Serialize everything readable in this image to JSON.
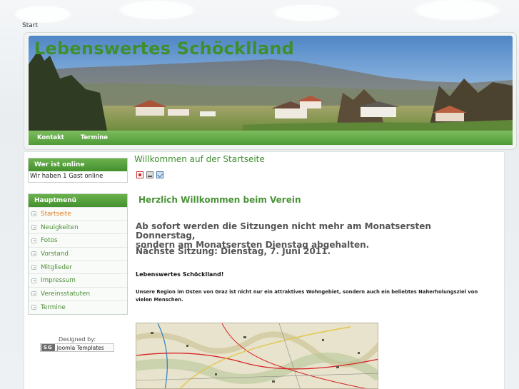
{
  "breadcrumb": "Start",
  "site": {
    "title": "Lebenswertes Schöcklland"
  },
  "topnav": {
    "items": [
      "Kontakt",
      "Termine"
    ]
  },
  "online_module": {
    "title": "Wer ist online",
    "text": "Wir haben 1 Gast online"
  },
  "main_menu": {
    "title": "Hauptmenü",
    "items": [
      "Startseite",
      "Neuigkeiten",
      "Fotos",
      "Vorstand",
      "Mitglieder",
      "Impressum",
      "Vereinsstatuten",
      "Termine"
    ],
    "active": "Startseite"
  },
  "footer_credit": {
    "designed_by": "Designed by:",
    "badge_logo": "SG",
    "badge_text": "Joomla Templates"
  },
  "article": {
    "title": "Willkommen auf der Startseite",
    "icons": [
      "pdf-icon",
      "print-icon",
      "email-icon"
    ],
    "welcome": "Herzlich Willkommen beim Verein",
    "notice_line1": "Ab sofort werden die Sitzungen nicht mehr am Monatsersten Donnerstag,",
    "notice_line2": "sondern am Monatsersten Dienstag abgehalten.",
    "next_session": "Nächste Sitzung: Dienstag, 7. Juni 2011.",
    "org_name": "Lebenswertes Schöcklland!",
    "description": "Unsere Region im Osten von Graz ist nicht nur ein attraktives Wohngebiet, sondern auch ein beliebtes Naherholungsziel von vielen Menschen."
  },
  "colors": {
    "brand_green": "#3f8f2e",
    "menu_active": "#e07a1f"
  }
}
